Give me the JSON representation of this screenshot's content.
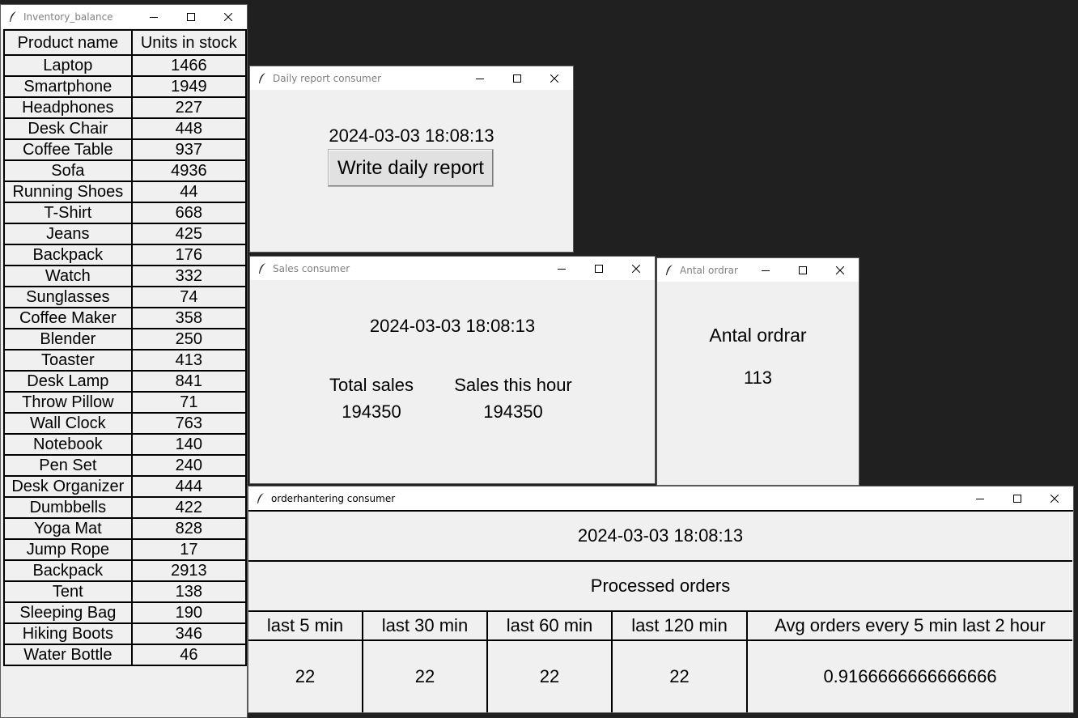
{
  "inventory": {
    "title": "Inventory_balance",
    "headers": [
      "Product name",
      "Units in stock"
    ],
    "rows": [
      [
        "Laptop",
        "1466"
      ],
      [
        "Smartphone",
        "1949"
      ],
      [
        "Headphones",
        "227"
      ],
      [
        "Desk Chair",
        "448"
      ],
      [
        "Coffee Table",
        "937"
      ],
      [
        "Sofa",
        "4936"
      ],
      [
        "Running Shoes",
        "44"
      ],
      [
        "T-Shirt",
        "668"
      ],
      [
        "Jeans",
        "425"
      ],
      [
        "Backpack",
        "176"
      ],
      [
        "Watch",
        "332"
      ],
      [
        "Sunglasses",
        "74"
      ],
      [
        "Coffee Maker",
        "358"
      ],
      [
        "Blender",
        "250"
      ],
      [
        "Toaster",
        "413"
      ],
      [
        "Desk Lamp",
        "841"
      ],
      [
        "Throw Pillow",
        "71"
      ],
      [
        "Wall Clock",
        "763"
      ],
      [
        "Notebook",
        "140"
      ],
      [
        "Pen Set",
        "240"
      ],
      [
        "Desk Organizer",
        "444"
      ],
      [
        "Dumbbells",
        "422"
      ],
      [
        "Yoga Mat",
        "828"
      ],
      [
        "Jump Rope",
        "17"
      ],
      [
        "Backpack",
        "2913"
      ],
      [
        "Tent",
        "138"
      ],
      [
        "Sleeping Bag",
        "190"
      ],
      [
        "Hiking Boots",
        "346"
      ],
      [
        "Water Bottle",
        "46"
      ]
    ]
  },
  "daily": {
    "title": "Daily report consumer",
    "timestamp": "2024-03-03 18:08:13",
    "button_label": "Write daily report"
  },
  "sales": {
    "title": "Sales consumer",
    "timestamp": "2024-03-03 18:08:13",
    "total_label": "Total sales",
    "total_value": "194350",
    "hour_label": "Sales this hour",
    "hour_value": "194350"
  },
  "antal": {
    "title": "Antal ordrar",
    "label": "Antal ordrar",
    "value": "113"
  },
  "orders": {
    "title": "orderhantering consumer",
    "timestamp": "2024-03-03 18:08:13",
    "heading": "Processed orders",
    "columns": [
      "last 5 min",
      "last 30 min",
      "last 60 min",
      "last 120 min",
      "Avg orders every 5 min last 2 hour"
    ],
    "values": [
      "22",
      "22",
      "22",
      "22",
      "0.9166666666666666"
    ]
  },
  "icons": [
    "feather-icon",
    "minimize-icon",
    "maximize-icon",
    "close-icon"
  ],
  "colors": {
    "desktop": "#202020",
    "window_bg": "#f0f0f0",
    "titlebar": "#ffffff",
    "title_text": "#808080"
  }
}
